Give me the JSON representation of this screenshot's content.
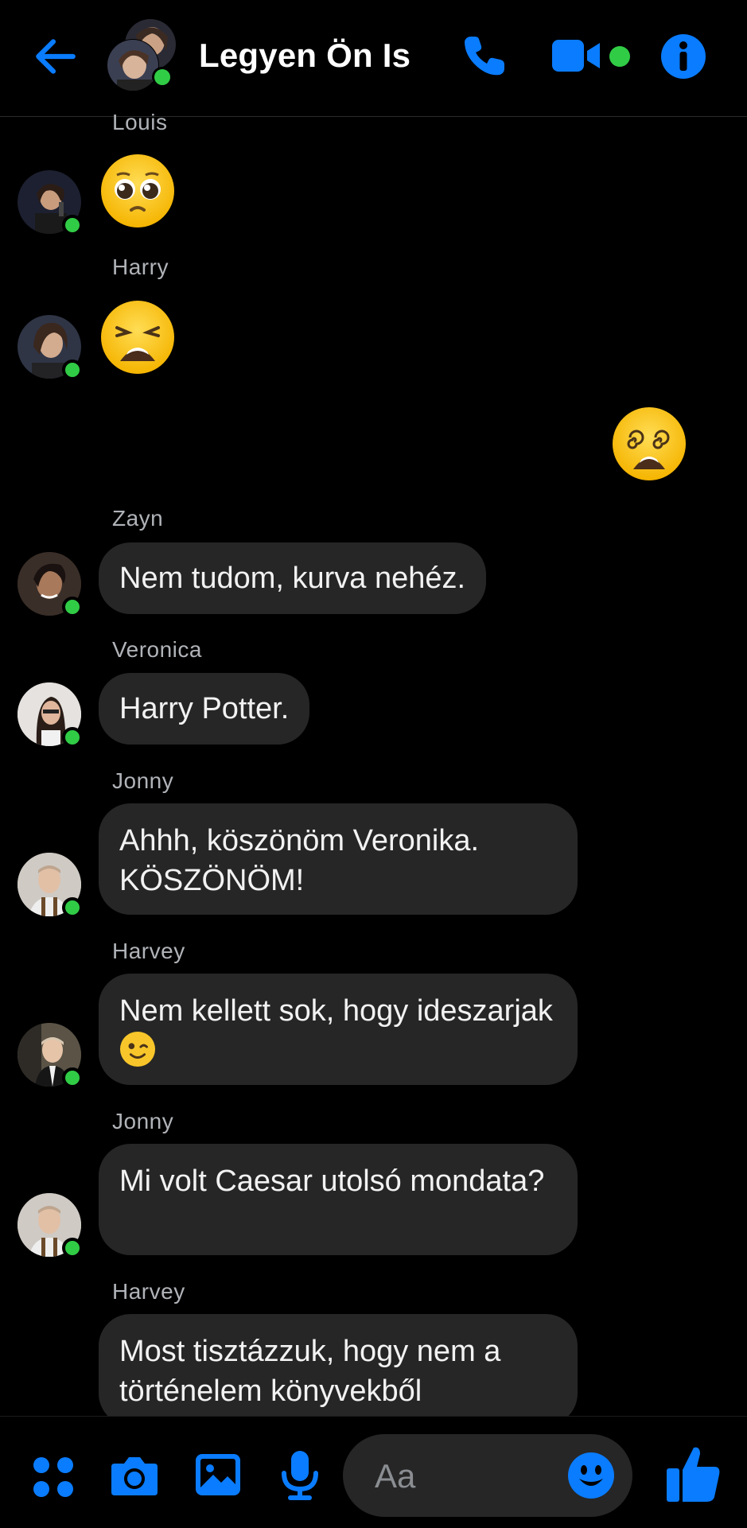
{
  "header": {
    "title": "Legyen Ön Is",
    "icons": [
      "back-arrow-icon",
      "group-avatar",
      "phone-icon",
      "video-camera-icon",
      "info-icon"
    ],
    "accent_color": "#0a7cff",
    "online_color": "#31cc46"
  },
  "messages": [
    {
      "sender": "Louis",
      "type": "emoji",
      "emoji": "pleading-face"
    },
    {
      "sender": "Harry",
      "type": "emoji",
      "emoji": "weary-face"
    },
    {
      "sender": "",
      "type": "emoji-outgoing",
      "emoji": "dizzy-face"
    },
    {
      "sender": "Zayn",
      "text": "Nem tudom, kurva nehéz."
    },
    {
      "sender": "Veronica",
      "text": "Harry Potter."
    },
    {
      "sender": "Jonny",
      "text": "Ahhh, köszönöm Veronika. KÖSZÖNÖM!"
    },
    {
      "sender": "Harvey",
      "text": "Nem kellett sok, hogy ideszarjak",
      "trailing_emoji": "winking-face"
    },
    {
      "sender": "Jonny",
      "text": "Mi volt Caesar utolsó mondata?"
    },
    {
      "sender": "Harvey",
      "text": "Most tisztázzuk, hogy nem a történelem könyvekből"
    }
  ],
  "composer": {
    "placeholder": "Aa",
    "icons": [
      "apps-menu-icon",
      "camera-icon",
      "gallery-icon",
      "microphone-icon",
      "emoji-icon",
      "thumbs-up-icon"
    ]
  },
  "colors": {
    "background": "#000000",
    "bubble": "#262626",
    "sender_label": "#b0b3b8"
  }
}
